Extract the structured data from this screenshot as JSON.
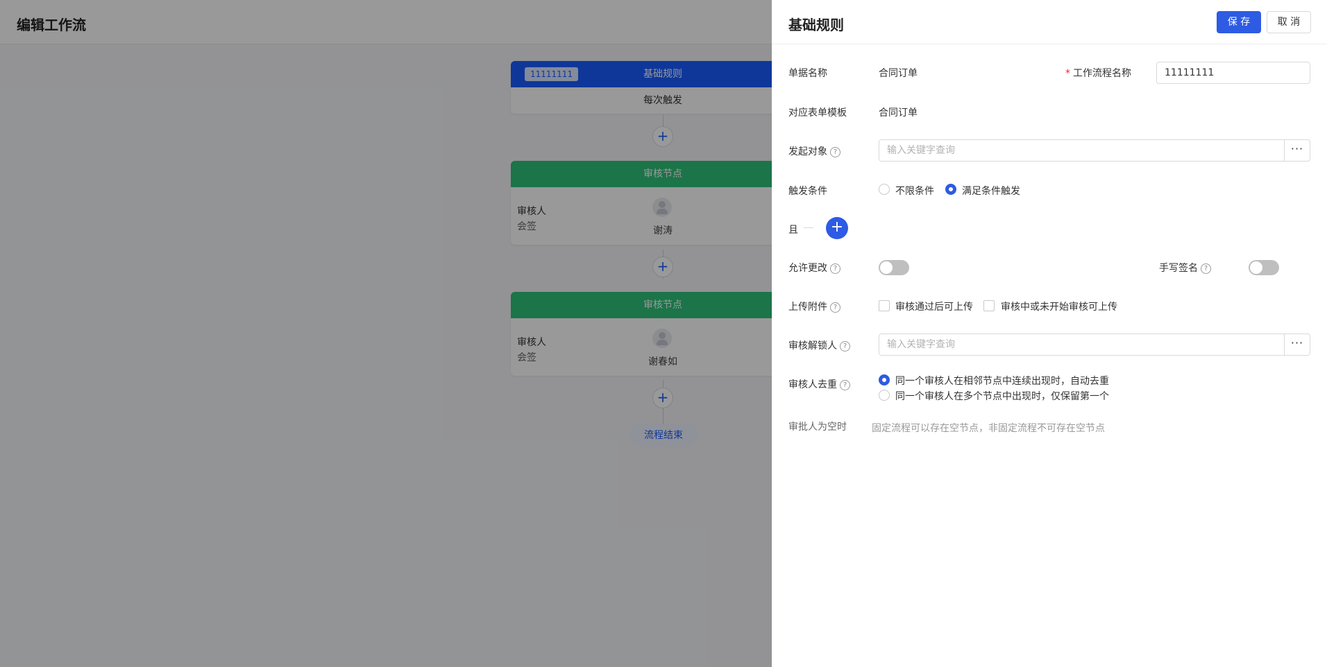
{
  "page": {
    "title": "编辑工作流"
  },
  "flow": {
    "start_node": {
      "id_tag": "11111111",
      "title": "基础规则",
      "trigger": "每次触发"
    },
    "review_nodes": [
      {
        "title": "审核节点",
        "reviewer_label": "审核人",
        "mode": "会签",
        "reviewer_name": "谢涛"
      },
      {
        "title": "审核节点",
        "reviewer_label": "审核人",
        "mode": "会签",
        "reviewer_name": "谢春如"
      }
    ],
    "add_symbol": "+",
    "end_label": "流程结束"
  },
  "panel": {
    "title": "基础规则",
    "save_label": "保 存",
    "cancel_label": "取 消",
    "doc_name_label": "单据名称",
    "doc_name_value": "合同订单",
    "workflow_name_label": "工作流程名称",
    "workflow_name_value": "11111111",
    "form_template_label": "对应表单模板",
    "form_template_value": "合同订单",
    "initiator_label": "发起对象",
    "initiator_placeholder": "输入关键字查询",
    "trigger_label": "触发条件",
    "trigger_options": [
      "不限条件",
      "满足条件触发"
    ],
    "trigger_selected": "满足条件触发",
    "and_label": "且",
    "allow_edit_label": "允许更改",
    "allow_edit_on": false,
    "handwritten_label": "手写签名",
    "handwritten_on": false,
    "upload_label": "上传附件",
    "upload_options": [
      "审核通过后可上传",
      "审核中或未开始审核可上传"
    ],
    "unlocker_label": "审核解锁人",
    "unlocker_placeholder": "输入关键字查询",
    "dedup_label": "审核人去重",
    "dedup_options": [
      "同一个审核人在相邻节点中连续出现时，自动去重",
      "同一个审核人在多个节点中出现时，仅保留第一个"
    ],
    "dedup_selected": "同一个审核人在相邻节点中连续出现时，自动去重",
    "empty_approver_label": "审批人为空时",
    "empty_approver_hint": "固定流程可以存在空节点，非固定流程不可存在空节点",
    "help_symbol": "?",
    "more_symbol": "···"
  }
}
